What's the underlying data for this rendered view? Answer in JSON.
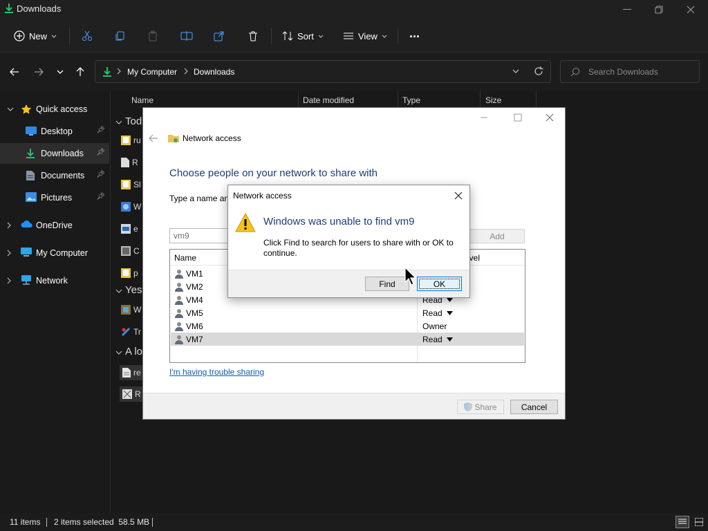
{
  "explorer": {
    "window_title": "Downloads",
    "toolbar": {
      "new_label": "New",
      "sort_label": "Sort",
      "view_label": "View",
      "more_label": "..."
    },
    "breadcrumb": [
      "My Computer",
      "Downloads"
    ],
    "search_placeholder": "Search Downloads",
    "nav": {
      "quick_access": "Quick access",
      "items": [
        "Desktop",
        "Downloads",
        "Documents",
        "Pictures"
      ],
      "onedrive": "OneDrive",
      "my_computer": "My Computer",
      "network": "Network"
    },
    "columns": [
      "Name",
      "Date modified",
      "Type",
      "Size"
    ],
    "groups": [
      "Tod",
      "Yest",
      "A lo"
    ],
    "row_fragments": [
      "ru",
      "R",
      "Sl",
      "W",
      "e",
      "C",
      "p",
      "W",
      "Tr",
      "re",
      "R"
    ],
    "status": {
      "items": "11 items",
      "selected": "2 items selected  58.5 MB"
    },
    "accent": "#27c06e"
  },
  "net_dialog": {
    "title": "Network access",
    "heading": "Choose people on your network to share with",
    "instruction": "Type a name and",
    "input_value": "vm9",
    "add_label": "Add",
    "list_header": {
      "name": "Name",
      "perm": "evel"
    },
    "rows": [
      {
        "name": "VM1",
        "perm": ""
      },
      {
        "name": "VM2",
        "perm": ""
      },
      {
        "name": "VM4",
        "perm": "Read"
      },
      {
        "name": "VM5",
        "perm": "Read"
      },
      {
        "name": "VM6",
        "perm": "Owner"
      },
      {
        "name": "VM7",
        "perm": "Read"
      }
    ],
    "trouble_link": "I'm having trouble sharing",
    "share_label": "Share",
    "cancel_label": "Cancel"
  },
  "error_dialog": {
    "title": "Network access",
    "heading": "Windows was unable to find vm9",
    "body": "Click Find to search for users to share with or OK to continue.",
    "find_label": "Find",
    "ok_label": "OK"
  }
}
